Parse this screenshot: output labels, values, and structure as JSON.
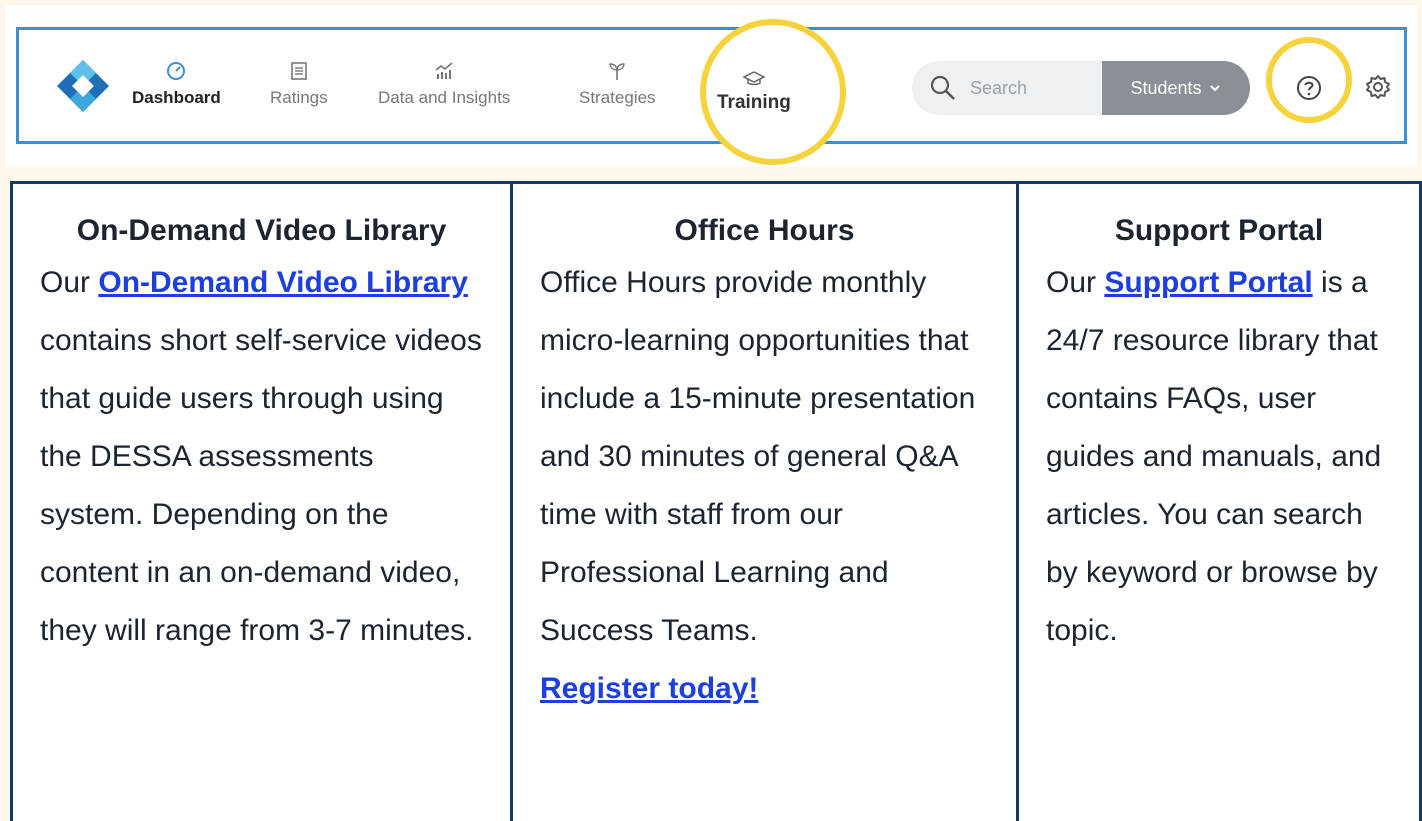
{
  "nav": {
    "items": [
      {
        "label": "Dashboard",
        "icon": "gauge-icon",
        "active": true
      },
      {
        "label": "Ratings",
        "icon": "list-icon",
        "active": false
      },
      {
        "label": "Data and Insights",
        "icon": "chart-icon",
        "active": false
      },
      {
        "label": "Strategies",
        "icon": "sprout-icon",
        "active": false
      },
      {
        "label": "Training",
        "icon": "graduation-cap-icon",
        "active": false,
        "highlighted": true
      }
    ],
    "search_placeholder": "Search",
    "scope_dropdown": "Students",
    "help_icon": "question-circle-icon",
    "settings_icon": "gear-icon"
  },
  "cards": [
    {
      "title": "On-Demand Video Library",
      "pre": "Our ",
      "link": "On-Demand Video Library ",
      "post": "contains short self-service videos that guide users through using the DESSA assessments system. Depending on the content in an on-demand video, they will range from 3-7 minutes."
    },
    {
      "title": "Office Hours",
      "body": "Office Hours provide monthly micro-learning opportunities that include a 15-minute presentation and 30 minutes of general Q&A time with staff from our Professional Learning and Success Teams.",
      "link": "Register today!"
    },
    {
      "title": "Support Portal",
      "pre": "Our ",
      "link": "Support Portal",
      "post": " is a 24/7 resource library that contains FAQs, user guides and manuals, and articles. You can search by keyword or browse by topic."
    }
  ],
  "colors": {
    "highlight_ring": "#f6d23d",
    "nav_border": "#3a8fd6",
    "card_border": "#143a62",
    "link": "#1d3fe0"
  }
}
